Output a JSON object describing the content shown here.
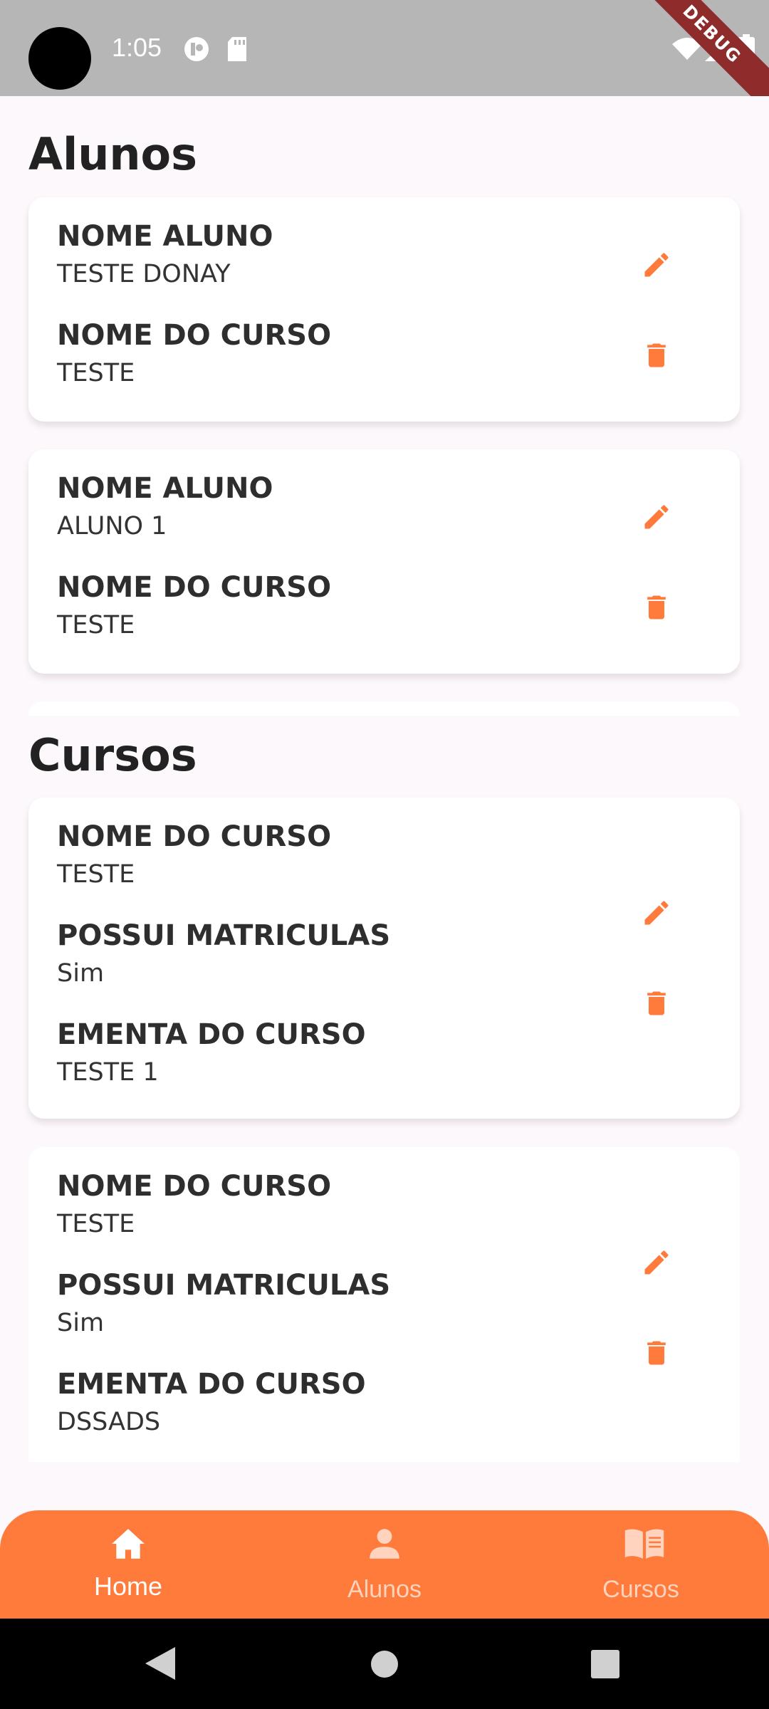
{
  "status_bar": {
    "time": "1:05",
    "debug_label": "DEBUG"
  },
  "alunos_section": {
    "title": "Alunos",
    "cards": [
      {
        "label1": "NOME ALUNO",
        "value1": "TESTE DONAY",
        "label2": "NOME DO CURSO",
        "value2": "TESTE"
      },
      {
        "label1": "NOME ALUNO",
        "value1": "ALUNO 1",
        "label2": "NOME DO CURSO",
        "value2": "TESTE"
      }
    ]
  },
  "cursos_section": {
    "title": "Cursos",
    "cards": [
      {
        "label1": "NOME DO CURSO",
        "value1": "TESTE",
        "label2": "POSSUI MATRICULAS",
        "value2": "Sim",
        "label3": "EMENTA DO CURSO",
        "value3": "TESTE 1"
      },
      {
        "label1": "NOME DO CURSO",
        "value1": "TESTE",
        "label2": "POSSUI MATRICULAS",
        "value2": "Sim",
        "label3": "EMENTA DO CURSO",
        "value3": "DSSADS"
      }
    ]
  },
  "bottom_nav": {
    "items": [
      {
        "label": "Home",
        "icon": "home-icon",
        "active": true
      },
      {
        "label": "Alunos",
        "icon": "person-icon",
        "active": false
      },
      {
        "label": "Cursos",
        "icon": "book-icon",
        "active": false
      }
    ]
  },
  "colors": {
    "accent": "#fe7b3b",
    "background": "#fdf8fc",
    "status_bar": "#b6b6b6"
  }
}
